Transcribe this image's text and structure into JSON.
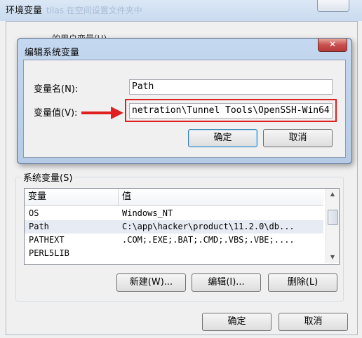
{
  "outer_window": {
    "title": "环境变量",
    "ghost_text": "tilas 在空间设置文件夹中",
    "user_vars_label": "的用户变量(U)",
    "system_vars_label": "系统变量(S)",
    "columns": [
      "变量",
      "值"
    ],
    "system_vars": [
      {
        "name": "OS",
        "value": "Windows_NT"
      },
      {
        "name": "Path",
        "value": "C:\\app\\hacker\\product\\11.2.0\\db..."
      },
      {
        "name": "PATHEXT",
        "value": ".COM;.EXE;.BAT;.CMD;.VBS;.VBE;...."
      },
      {
        "name": "PERL5LIB",
        "value": ""
      }
    ],
    "new_button": "新建(W)...",
    "edit_button": "编辑(I)...",
    "delete_button": "删除(L)",
    "ok_button": "确定",
    "cancel_button": "取消"
  },
  "edit_dialog": {
    "title": "编辑系统变量",
    "close_glyph": "✕",
    "name_label": "变量名(N):",
    "name_value": "Path",
    "value_label": "变量值(V):",
    "value_value": "netration\\Tunnel Tools\\OpenSSH-Win64",
    "ok_button": "确定",
    "cancel_button": "取消"
  },
  "annotation": {
    "arrow_color": "#e02020",
    "highlight_color": "#e02020"
  }
}
